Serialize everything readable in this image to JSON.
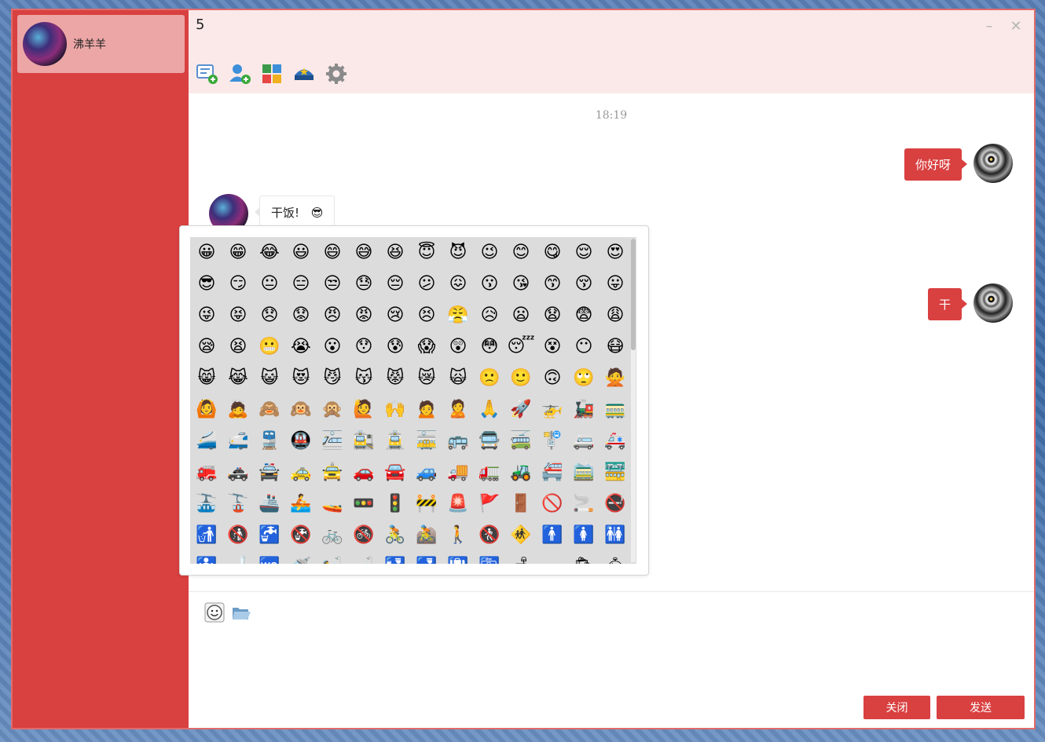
{
  "sidebar": {
    "contact": {
      "name": "沸羊羊"
    }
  },
  "header": {
    "title": "5",
    "minimize_icon": "–",
    "close_icon": "✕",
    "tools": [
      "add-chat-icon",
      "add-user-icon",
      "apps-icon",
      "police-hat-icon",
      "settings-icon"
    ]
  },
  "messages": {
    "time": "18:19",
    "items": [
      {
        "direction": "out",
        "text": "你好呀"
      },
      {
        "direction": "in",
        "text": "干饭!",
        "emoji": "😎"
      },
      {
        "direction": "out",
        "text": "干"
      }
    ]
  },
  "emoji_panel": {
    "emojis": [
      "😀",
      "😁",
      "😂",
      "😃",
      "😄",
      "😅",
      "😆",
      "😇",
      "😈",
      "😉",
      "😊",
      "😋",
      "😌",
      "😍",
      "😎",
      "😏",
      "😐",
      "😑",
      "😒",
      "😓",
      "😔",
      "😕",
      "😖",
      "😗",
      "😘",
      "😙",
      "😚",
      "😛",
      "😜",
      "😝",
      "😞",
      "😟",
      "😠",
      "😡",
      "😢",
      "😣",
      "😤",
      "😥",
      "😦",
      "😧",
      "😨",
      "😩",
      "😪",
      "😫",
      "😬",
      "😭",
      "😮",
      "😯",
      "😰",
      "😱",
      "😲",
      "😳",
      "😴",
      "😵",
      "😶",
      "😷",
      "😸",
      "😹",
      "😺",
      "😻",
      "😼",
      "😽",
      "😾",
      "😿",
      "🙀",
      "🙁",
      "🙂",
      "🙃",
      "🙄",
      "🙅",
      "🙆",
      "🙇",
      "🙈",
      "🙉",
      "🙊",
      "🙋",
      "🙌",
      "🙍",
      "🙎",
      "🙏",
      "🚀",
      "🚁",
      "🚂",
      "🚃",
      "🚄",
      "🚅",
      "🚆",
      "🚇",
      "🚈",
      "🚉",
      "🚊",
      "🚋",
      "🚌",
      "🚍",
      "🚎",
      "🚏",
      "🚐",
      "🚑",
      "🚒",
      "🚓",
      "🚔",
      "🚕",
      "🚖",
      "🚗",
      "🚘",
      "🚙",
      "🚚",
      "🚛",
      "🚜",
      "🚝",
      "🚞",
      "🚟",
      "🚠",
      "🚡",
      "🚢",
      "🚣",
      "🚤",
      "🚥",
      "🚦",
      "🚧",
      "🚨",
      "🚩",
      "🚪",
      "🚫",
      "🚬",
      "🚭",
      "🚮",
      "🚯",
      "🚰",
      "🚱",
      "🚲",
      "🚳",
      "🚴",
      "🚵",
      "🚶",
      "🚷",
      "🚸",
      "🚹",
      "🚺",
      "🚻",
      "🚼",
      "🚽",
      "🚾",
      "🚿",
      "🛀",
      "🛁",
      "🛂",
      "🛃",
      "🛄",
      "🛅",
      "🛋",
      "🛌",
      "🛍",
      "🛎"
    ]
  },
  "input": {
    "tools": [
      "smiley-icon",
      "folder-icon"
    ],
    "value": ""
  },
  "buttons": {
    "close_label": "关闭",
    "send_label": "发送"
  },
  "colors": {
    "accent": "#d94040",
    "sidebar_selected": "#eca6a6",
    "header_bg": "#fbe9e9"
  }
}
